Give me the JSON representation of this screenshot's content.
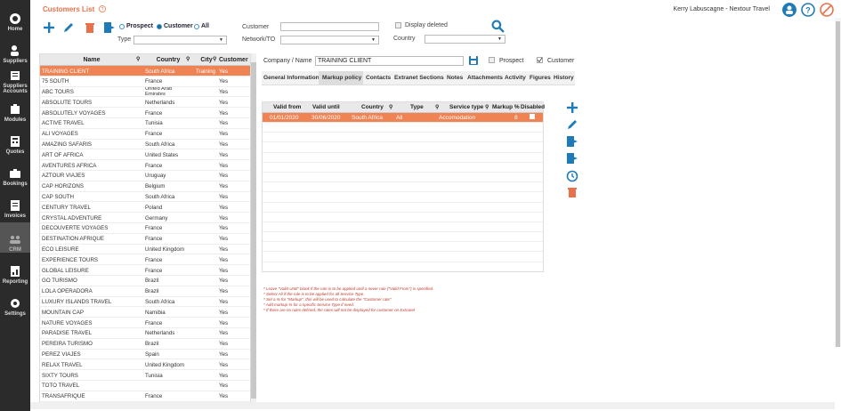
{
  "sidebar": {
    "items": [
      {
        "label": "Home",
        "icon": "home-icon"
      },
      {
        "label": "Suppliers",
        "icon": "suppliers-icon"
      },
      {
        "label": "Suppliers Accounts",
        "icon": "suppliers-accounts-icon"
      },
      {
        "label": "Modules",
        "icon": "modules-icon"
      },
      {
        "label": "Quotes",
        "icon": "quotes-icon"
      },
      {
        "label": "Bookings",
        "icon": "bookings-icon"
      },
      {
        "label": "Invoices",
        "icon": "invoices-icon"
      },
      {
        "label": "CRM",
        "icon": "crm-icon"
      },
      {
        "label": "Reporting",
        "icon": "reporting-icon"
      },
      {
        "label": "Settings",
        "icon": "settings-icon"
      }
    ]
  },
  "header": {
    "title": "Customers List",
    "help_icon": "?",
    "user": "Kerry Labuscagne - Nextour Travel"
  },
  "filters": {
    "radio_prospect": "Prospect",
    "radio_customer": "Customer",
    "radio_all": "All",
    "type_label": "Type",
    "customer_label": "Customer",
    "network_label": "Network/TO",
    "display_deleted": "Display deleted",
    "country_label": "Country"
  },
  "list": {
    "headers": {
      "name": "Name",
      "country": "Country",
      "city": "City",
      "customer": "Customer"
    },
    "rows": [
      {
        "name": "TRAINING CLIENT",
        "country": "South Africa",
        "city": "Training",
        "customer": "Yes"
      },
      {
        "name": "75 SOUTH",
        "country": "France",
        "city": "",
        "customer": "Yes"
      },
      {
        "name": "ABC TOURS",
        "country": "United Arab Emirates",
        "city": "",
        "customer": "Yes"
      },
      {
        "name": "ABSOLUTE TOURS",
        "country": "Netherlands",
        "city": "",
        "customer": "Yes"
      },
      {
        "name": "ABSOLUTELY VOYAGES",
        "country": "France",
        "city": "",
        "customer": "Yes"
      },
      {
        "name": "ACTIVE TRAVEL",
        "country": "Tunisia",
        "city": "",
        "customer": "Yes"
      },
      {
        "name": "ALI VOYAGES",
        "country": "France",
        "city": "",
        "customer": "Yes"
      },
      {
        "name": "AMAZING SAFARIS",
        "country": "South Africa",
        "city": "",
        "customer": "Yes"
      },
      {
        "name": "ART OF AFRICA",
        "country": "United States",
        "city": "",
        "customer": "Yes"
      },
      {
        "name": "AVENTURES AFRICA",
        "country": "France",
        "city": "",
        "customer": "Yes"
      },
      {
        "name": "AZTOUR VIAJES",
        "country": "Uruguay",
        "city": "",
        "customer": "Yes"
      },
      {
        "name": "CAP HORIZONS",
        "country": "Belgium",
        "city": "",
        "customer": "Yes"
      },
      {
        "name": "CAP SOUTH",
        "country": "South Africa",
        "city": "",
        "customer": "Yes"
      },
      {
        "name": "CENTURY TRAVEL",
        "country": "Poland",
        "city": "",
        "customer": "Yes"
      },
      {
        "name": "CRYSTAL ADVENTURE",
        "country": "Germany",
        "city": "",
        "customer": "Yes"
      },
      {
        "name": "DECOUVERTE VOYAGES",
        "country": "France",
        "city": "",
        "customer": "Yes"
      },
      {
        "name": "DESTINATION AFRIQUE",
        "country": "France",
        "city": "",
        "customer": "Yes"
      },
      {
        "name": "ECO LEISURE",
        "country": "United Kingdom",
        "city": "",
        "customer": "Yes"
      },
      {
        "name": "EXPERIENCE TOURS",
        "country": "France",
        "city": "",
        "customer": "Yes"
      },
      {
        "name": "GLOBAL LEISURE",
        "country": "France",
        "city": "",
        "customer": "Yes"
      },
      {
        "name": "GO TURISMO",
        "country": "Brazil",
        "city": "",
        "customer": "Yes"
      },
      {
        "name": "LOLA OPERADORA",
        "country": "Brazil",
        "city": "",
        "customer": "Yes"
      },
      {
        "name": "LUXURY ISLANDS TRAVEL",
        "country": "South Africa",
        "city": "",
        "customer": "Yes"
      },
      {
        "name": "MOUNTAIN CAP",
        "country": "Namibia",
        "city": "",
        "customer": "Yes"
      },
      {
        "name": "NATURE VOYAGES",
        "country": "France",
        "city": "",
        "customer": "Yes"
      },
      {
        "name": "PARADISE TRAVEL",
        "country": "Netherlands",
        "city": "",
        "customer": "Yes"
      },
      {
        "name": "PEREIRA TURISMO",
        "country": "Brazil",
        "city": "",
        "customer": "Yes"
      },
      {
        "name": "PEREZ VIAJES",
        "country": "Spain",
        "city": "",
        "customer": "Yes"
      },
      {
        "name": "RELAX TRAVEL",
        "country": "United Kingdom",
        "city": "",
        "customer": "Yes"
      },
      {
        "name": "SIXTY TOURS",
        "country": "Tunisia",
        "city": "",
        "customer": "Yes"
      },
      {
        "name": "TOTO TRAVEL",
        "country": "",
        "city": "",
        "customer": "Yes"
      },
      {
        "name": "TRANSAFRIQUE",
        "country": "France",
        "city": "",
        "customer": "Yes"
      }
    ]
  },
  "detail": {
    "company_label": "Company / Name",
    "company_value": "TRAINING CLIENT",
    "prospect_label": "Prospect",
    "customer_label": "Customer",
    "tabs": [
      "General Information",
      "Markup policy",
      "Contacts",
      "Extranet Sections",
      "Notes",
      "Attachments",
      "Activity",
      "Figures",
      "History"
    ],
    "active_tab": "Markup policy"
  },
  "markup": {
    "headers": {
      "valid_from": "Valid from",
      "valid_until": "Valid until",
      "country": "Country",
      "type": "Type",
      "service_type": "Service type",
      "markup": "Markup %",
      "disabled": "Disabled"
    },
    "rows": [
      {
        "valid_from": "01/01/2020",
        "valid_until": "30/06/2020",
        "country": "South Africa",
        "type": "All",
        "service_type": "Accomodation",
        "markup": "8"
      }
    ],
    "notes": [
      "* Leave \"Valid Until\" blank if the rule is to be applied until a never rule (\"Valid From\") is specified.",
      "* Select All if the rule is to be applied for all Service Type.",
      "* Set a % for \"Markup\", this will be used to calculate the \"Customer rate\".",
      "* Add markup % for a specific Service Type if need.",
      "* If there are no rules defined, the rates will not be displayed for customer on Extranet"
    ]
  },
  "colors": {
    "accent": "#e8704a",
    "selected_row": "#f08354",
    "action_blue": "#1e7bb8",
    "sidebar": "#2b2b2b"
  }
}
